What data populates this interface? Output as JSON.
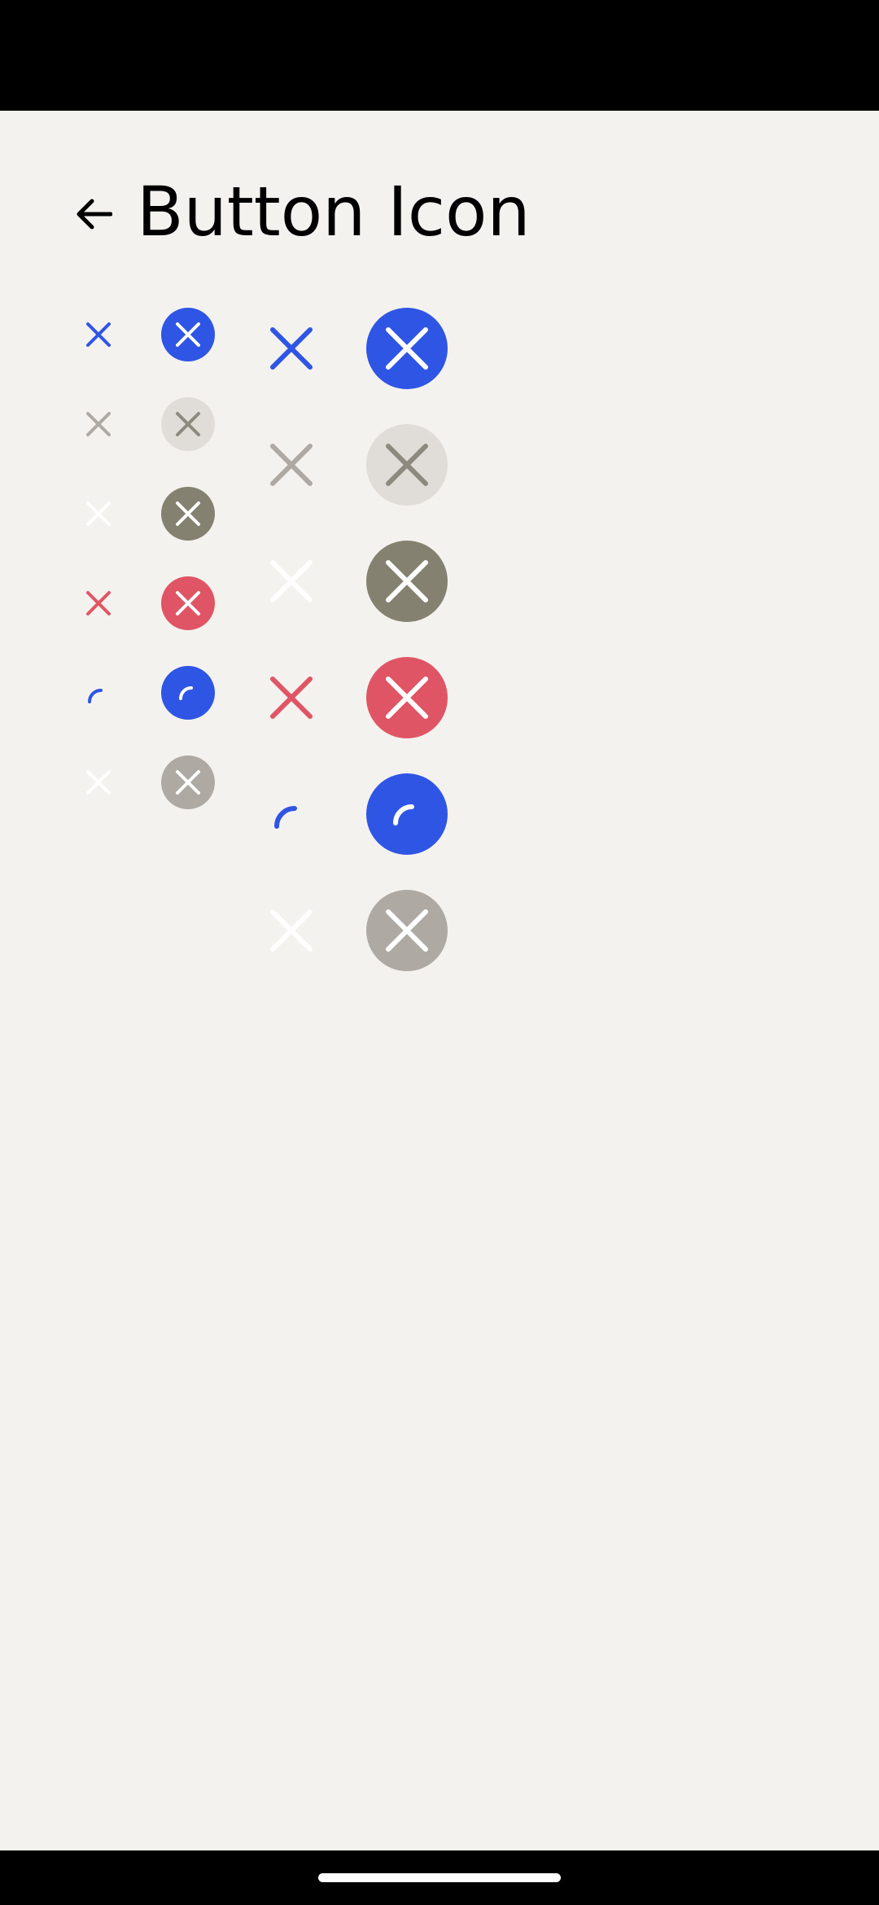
{
  "header": {
    "title": "Button Icon",
    "back_icon": "arrow-left-icon"
  },
  "icons": {
    "close": "close-icon",
    "spinner": "loading-spinner-icon"
  },
  "colors": {
    "background": "#f4f2ef",
    "primary": "#2f55e4",
    "secondary_icon": "#aeaaa3",
    "secondary_fill": "#e0ddd8",
    "secondary_filled_icon": "#8e897f",
    "dark_fill": "#858170",
    "danger": "#e05565",
    "disabled_fill": "#aeaaa3",
    "white": "#ffffff"
  },
  "rows": [
    {
      "variant": "primary",
      "loading": false,
      "disabled": false
    },
    {
      "variant": "secondary",
      "loading": false,
      "disabled": false
    },
    {
      "variant": "tertiary",
      "loading": false,
      "disabled": false
    },
    {
      "variant": "danger",
      "loading": false,
      "disabled": false
    },
    {
      "variant": "primary",
      "loading": true,
      "disabled": false
    },
    {
      "variant": "disabled",
      "loading": false,
      "disabled": true
    }
  ]
}
